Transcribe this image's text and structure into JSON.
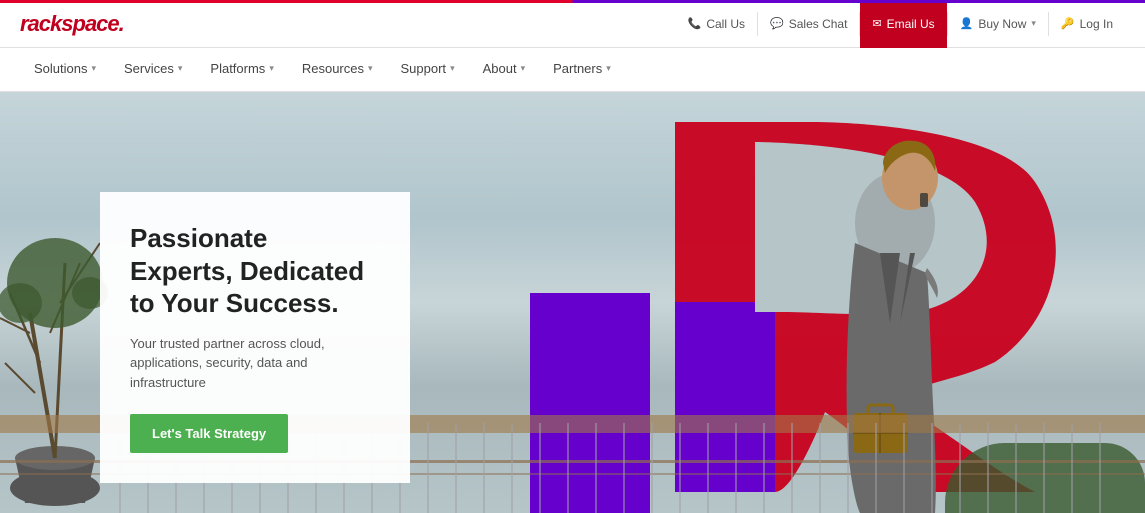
{
  "topBar": {
    "logo": "rackspace.",
    "actions": [
      {
        "id": "call-us",
        "label": "Call Us",
        "icon": "📞"
      },
      {
        "id": "sales-chat",
        "label": "Sales Chat",
        "icon": "💬"
      },
      {
        "id": "email-us",
        "label": "Email Us",
        "icon": "✉",
        "highlighted": true
      },
      {
        "id": "buy-now",
        "label": "Buy Now",
        "icon": "👤",
        "hasChevron": true
      },
      {
        "id": "log-in",
        "label": "Log In",
        "icon": "🔑"
      }
    ]
  },
  "nav": {
    "items": [
      {
        "id": "solutions",
        "label": "Solutions",
        "hasChevron": true
      },
      {
        "id": "services",
        "label": "Services",
        "hasChevron": true
      },
      {
        "id": "platforms",
        "label": "Platforms",
        "hasChevron": true
      },
      {
        "id": "resources",
        "label": "Resources",
        "hasChevron": true
      },
      {
        "id": "support",
        "label": "Support",
        "hasChevron": true
      },
      {
        "id": "about",
        "label": "About",
        "hasChevron": true
      },
      {
        "id": "partners",
        "label": "Partners",
        "hasChevron": true
      }
    ]
  },
  "hero": {
    "headline": "Passionate Experts, Dedicated to Your Success.",
    "subtext": "Your trusted partner across cloud, applications, security, data and infrastructure",
    "ctaLabel": "Let's Talk Strategy"
  }
}
